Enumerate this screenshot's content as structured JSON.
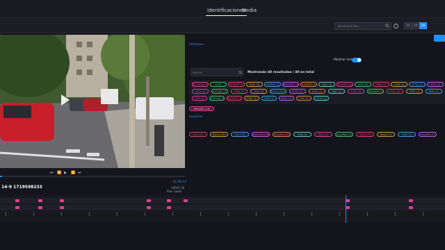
{
  "tabs": {
    "identifications": "Identificaciones",
    "media": "Media"
  },
  "toolbar": {
    "search_placeholder": "Búsqueda libre...",
    "help": "?",
    "grid_sizes": [
      "12",
      "15",
      "16"
    ],
    "grid_selected": "16"
  },
  "video": {
    "time": "16:36:43",
    "plate_caption": "14-9 1719598233",
    "meta_line1": "19041 18",
    "meta_line2": "Plan roads"
  },
  "panel": {
    "section_label": "Vehículos",
    "show_all_label": "Mostrar todo",
    "filter_placeholder": "Buscar",
    "results_text": "Mostrando 40 resultados / 40 en total",
    "selected_chip": "2690GBC (19)",
    "others_label": "Usuarios",
    "plates_row1": [
      "8901KHX (15)",
      "1234",
      "4678GFT (2)",
      "9812 (3)",
      "5678FJJ (1)",
      "8901KBC (2)",
      "3456JPD (3)",
      "3401 (1)",
      "1234TTY (2)",
      "4512 (4)",
      "7890 (1)",
      "2345 (2)",
      "6712 (1)",
      "9012 (2)"
    ],
    "plates_row2": [
      "5678 (4)",
      "3412JKL (2)",
      "7856 (1)",
      "2312 (3)",
      "8901LLM (2)",
      "6734 (1)",
      "4523 (2)",
      "9067 (1)",
      "1289 (3)",
      "5690NPR (1)",
      "3401 (2)",
      "1267 (1)",
      "8945 (2)"
    ],
    "plates_row3": [
      "3452 (1)",
      "4567GHJ (2)",
      "9012KLP (1)",
      "6789 (3)",
      "5634 (2)",
      "8901 (1)",
      "2345 (2)",
      "4512 (1)"
    ],
    "colors_row": [
      "Gris (12)",
      "Blanco (8)",
      "Gris (10)",
      "Hatchback/Sedan (4)",
      "Gris/Azul (3)",
      "Rojo (3)",
      "Rosa (2)",
      "Azul/Roja (1)",
      "Verde (2)",
      "Negro (1)",
      "Plata (3)",
      "Amarillo (1)"
    ]
  },
  "colors": {
    "accent": "#1e90ff",
    "magenta": "#e0409a",
    "background": "#14141c"
  }
}
